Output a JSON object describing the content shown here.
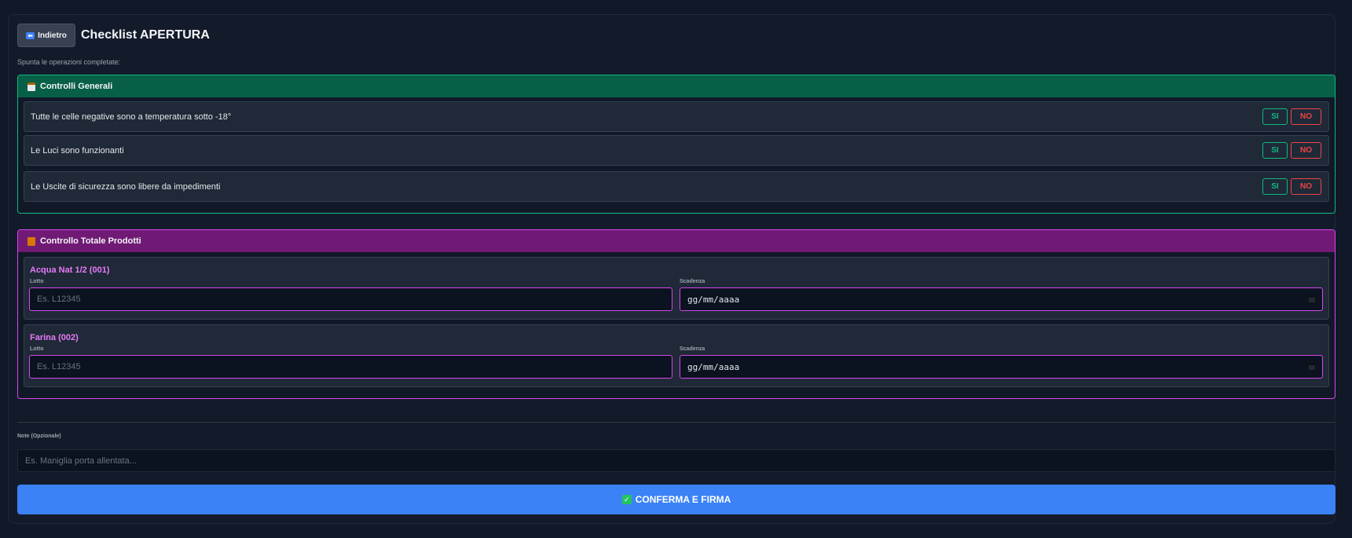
{
  "header": {
    "back_label": "Indietro",
    "back_icon": "back-arrow-icon",
    "title": "Checklist APERTURA",
    "subtitle": "Spunta le operazioni completate:"
  },
  "general": {
    "title": "Controlli Generali",
    "icon": "clipboard-icon",
    "accent": "#10b981",
    "items": [
      {
        "label": "Tutte le celle negative sono a temperatura sotto -18°",
        "yes": "SI",
        "no": "NO"
      },
      {
        "label": "Le Luci sono funzionanti",
        "yes": "SI",
        "no": "NO"
      },
      {
        "label": "Le Uscite di sicurezza sono libere da impedimenti",
        "yes": "SI",
        "no": "NO"
      }
    ]
  },
  "products": {
    "title": "Controllo Totale Prodotti",
    "icon": "package-icon",
    "accent": "#d946ef",
    "items": [
      {
        "name": "Acqua Nat 1/2 (001)",
        "lot_label": "Lotto",
        "lot_placeholder": "Es. L12345",
        "expiry_label": "Scadenza",
        "expiry_value": "gg/mm/aaaa"
      },
      {
        "name": "Farina (002)",
        "lot_label": "Lotto",
        "lot_placeholder": "Es. L12345",
        "expiry_label": "Scadenza",
        "expiry_value": "gg/mm/aaaa"
      }
    ]
  },
  "notes": {
    "label": "Note (Opzionale)",
    "placeholder": "Es. Maniglia porta allentata..."
  },
  "confirm": {
    "label": "CONFERMA E FIRMA",
    "icon": "checkmark-icon",
    "color": "#3b82f6"
  }
}
